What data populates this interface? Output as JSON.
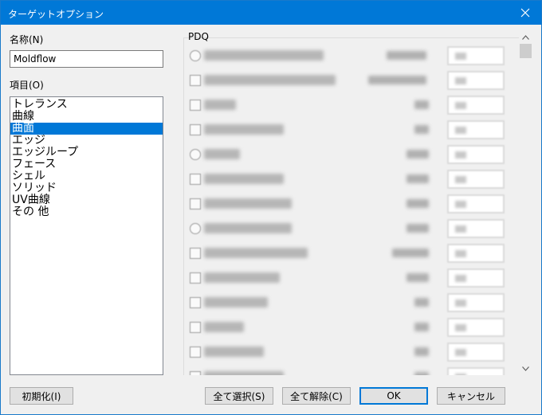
{
  "window": {
    "title": "ターゲットオプション"
  },
  "name_field": {
    "label": "名称(N)",
    "value": "Moldflow"
  },
  "items": {
    "label": "項目(O)",
    "list": [
      "トレランス",
      "曲線",
      "曲面",
      "エッジ",
      "エッジループ",
      "フェース",
      "シェル",
      "ソリッド",
      "UV曲線",
      "その 他"
    ],
    "selected_index": 2
  },
  "pdq": {
    "label": "PDQ"
  },
  "buttons": {
    "reset": "初期化(I)",
    "select_all": "全て選択(S)",
    "clear_all": "全て解除(C)",
    "ok": "OK",
    "cancel": "キャンセル"
  },
  "colors": {
    "titlebar": "#0078d7",
    "selection": "#0078d7",
    "dialog_bg": "#f0f0f0"
  },
  "icons": {
    "close": "close-icon",
    "scroll_up": "chevron-up-icon",
    "scroll_down": "chevron-down-icon"
  }
}
